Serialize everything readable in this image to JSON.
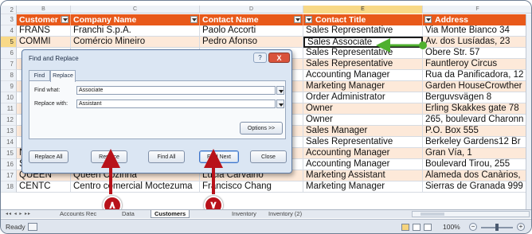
{
  "columns": {
    "letters": [
      "B",
      "C",
      "D",
      "E",
      "F"
    ],
    "selected": "E"
  },
  "table": {
    "headers": [
      "Customer ID",
      "Company Name",
      "Contact Name",
      "Contact Title",
      "Address"
    ],
    "rows": [
      {
        "num": "4",
        "cells": [
          "FRANS",
          "Franchi S.p.A.",
          "Paolo Accorti",
          "Sales Representative",
          "Via Monte Bianco 34"
        ]
      },
      {
        "num": "5",
        "cells": [
          "COMMI",
          "Comércio Mineiro",
          "Pedro Afonso",
          "Sales Associate",
          "Av. dos Lusíadas, 23"
        ]
      },
      {
        "num": "6",
        "cells": [
          "",
          "",
          "",
          "Sales Representative",
          "Obere Str. 57"
        ]
      },
      {
        "num": "7",
        "cells": [
          "",
          "",
          "",
          "Sales Representative",
          "Fauntleroy Circus"
        ]
      },
      {
        "num": "8",
        "cells": [
          "",
          "",
          "",
          "Accounting Manager",
          "Rua da Panificadora, 12"
        ]
      },
      {
        "num": "9",
        "cells": [
          "",
          "",
          "",
          "Marketing Manager",
          "Garden HouseCrowther"
        ]
      },
      {
        "num": "10",
        "cells": [
          "",
          "",
          "",
          "Order Administrator",
          "Berguvsvägen  8"
        ]
      },
      {
        "num": "11",
        "cells": [
          "",
          "",
          "",
          "Owner",
          "Erling Skakkes gate 78"
        ]
      },
      {
        "num": "12",
        "cells": [
          "",
          "",
          "",
          "Owner",
          "265, boulevard Charonn"
        ]
      },
      {
        "num": "13",
        "cells": [
          "",
          "",
          "",
          "Sales Manager",
          "P.O. Box 555"
        ]
      },
      {
        "num": "14",
        "cells": [
          "",
          "",
          "",
          "Sales Representative",
          "Berkeley Gardens12  Br"
        ]
      },
      {
        "num": "15",
        "cells": [
          "NORTH",
          "North/South",
          "Simon Crowther",
          "Accounting Manager",
          "Gran Vía, 1"
        ]
      },
      {
        "num": "16",
        "cells": [
          "SUPRD",
          "Suprêmes délices",
          "Pascale Cartrain",
          "Accounting Manager",
          "Boulevard Tirou, 255"
        ]
      },
      {
        "num": "17",
        "cells": [
          "QUEEN",
          "Queen Cozinha",
          "Lúcia Carvalho",
          "Marketing Assistant",
          "Alameda dos Canàrios,"
        ]
      },
      {
        "num": "18",
        "cells": [
          "CENTC",
          "Centro comercial Moctezuma",
          "Francisco Chang",
          "Marketing Manager",
          "Sierras de Granada 999"
        ]
      }
    ],
    "top_rownums": [
      "2",
      "3"
    ]
  },
  "dialog": {
    "title": "Find and Replace",
    "help": "?",
    "close": "X",
    "tabs": [
      "Find",
      "Replace"
    ],
    "find_label": "Find what:",
    "find_value": "Associate",
    "replace_label": "Replace with:",
    "replace_value": "Assistant",
    "options": "Options >>",
    "buttons": [
      "Replace All",
      "Replace",
      "Find All",
      "Find Next",
      "Close"
    ]
  },
  "sheets": {
    "nav": "◂◂ ◂ ▸ ▸▸",
    "tabs": [
      "Accounts Rec",
      "Data",
      "Customers",
      "Inventory",
      "Inventory (2)"
    ],
    "active": "Customers"
  },
  "status": {
    "ready": "Ready",
    "zoom": "100%",
    "zoom_minus": "−",
    "zoom_plus": "+"
  },
  "callouts": [
    "٨",
    "٧"
  ],
  "colors": {
    "header": "#e8591a",
    "callout": "#b8121a",
    "arrow": "#4fb02f",
    "alt_row": "#fde9d9"
  }
}
